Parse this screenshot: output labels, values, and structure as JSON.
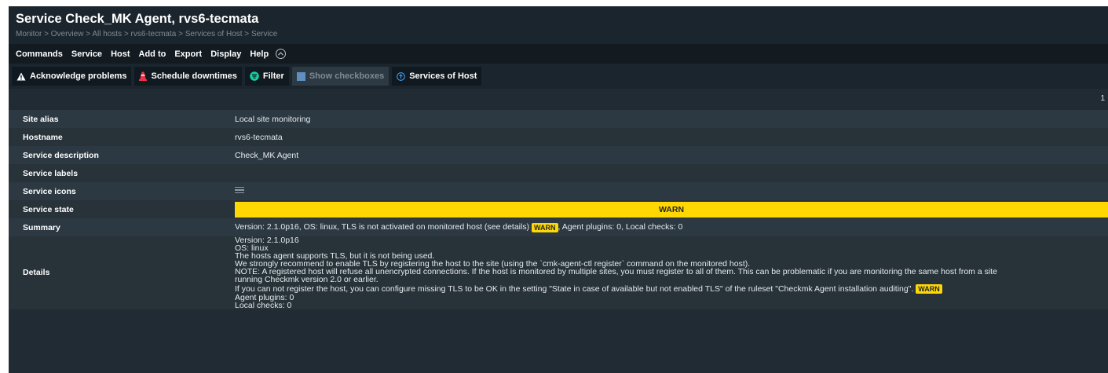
{
  "header": {
    "title": "Service Check_MK Agent, rvs6-tecmata",
    "breadcrumb": [
      "Monitor",
      "Overview",
      "All hosts",
      "rvs6-tecmata",
      "Services of Host",
      "Service"
    ],
    "breadcrumb_separator": " > "
  },
  "menu": {
    "items": [
      "Commands",
      "Service",
      "Host",
      "Add to",
      "Export",
      "Display",
      "Help"
    ]
  },
  "toolbar": {
    "acknowledge": "Acknowledge problems",
    "schedule": "Schedule downtimes",
    "filter": "Filter",
    "show_checkboxes": "Show checkboxes",
    "services_of_host": "Services of Host"
  },
  "pagination": {
    "page": "1"
  },
  "info": {
    "site_alias": {
      "label": "Site alias",
      "value": "Local site monitoring"
    },
    "hostname": {
      "label": "Hostname",
      "value": "rvs6-tecmata"
    },
    "service_description": {
      "label": "Service description",
      "value": "Check_MK Agent"
    },
    "service_labels": {
      "label": "Service labels",
      "value": ""
    },
    "service_icons": {
      "label": "Service icons",
      "icon": "menu-icon"
    },
    "service_state": {
      "label": "Service state",
      "value": "WARN"
    },
    "summary": {
      "label": "Summary",
      "text_before": "Version: 2.1.0p16, OS: linux, TLS is not activated on monitored host (see details) ",
      "badge": "WARN",
      "text_after": ", Agent plugins: 0, Local checks: 0"
    },
    "details": {
      "label": "Details",
      "lines": [
        "Version: 2.1.0p16",
        "OS: linux",
        "The hosts agent supports TLS, but it is not being used.",
        "We strongly recommend to enable TLS by registering the host to the site (using the `cmk-agent-ctl register` command on the monitored host).",
        "NOTE: A registered host will refuse all unencrypted connections. If the host is monitored by multiple sites, you must register to all of them. This can be problematic if you are monitoring the same host from a site",
        "running Checkmk version 2.0 or earlier."
      ],
      "tls_line": "If you can not register the host, you can configure missing TLS to be OK in the setting \"State in case of available but not enabled TLS\" of the ruleset \"Checkmk Agent installation auditing\". ",
      "tls_badge": "WARN",
      "tail_lines": [
        "Agent plugins: 0",
        "Local checks: 0"
      ]
    }
  },
  "colors": {
    "warn": "#ffd703",
    "background": "#202b33",
    "row_odd": "#2c3942",
    "row_even": "#273239"
  }
}
